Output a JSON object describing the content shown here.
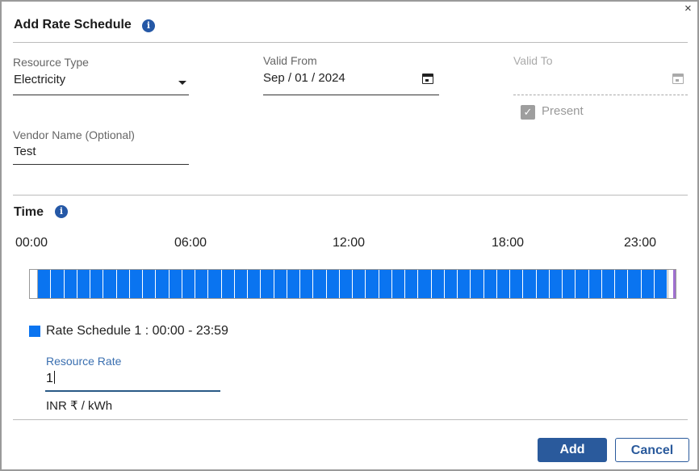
{
  "dialog": {
    "title": "Add Rate Schedule",
    "close": "×",
    "info_glyph": "i"
  },
  "form": {
    "resource_type": {
      "label": "Resource Type",
      "value": "Electricity"
    },
    "valid_from": {
      "label": "Valid From",
      "value": "Sep / 01 / 2024"
    },
    "valid_to": {
      "label": "Valid To",
      "value": ""
    },
    "present": {
      "label": "Present",
      "checked": true,
      "check_glyph": "✓"
    },
    "vendor_name": {
      "label": "Vendor Name (Optional)",
      "value": "Test"
    }
  },
  "time": {
    "title": "Time",
    "ticks": [
      "00:00",
      "06:00",
      "12:00",
      "18:00",
      "23:00"
    ],
    "slots": 48,
    "colors": {
      "selected": "#0a74f0"
    }
  },
  "schedule": {
    "legend": "Rate Schedule 1 : 00:00 - 23:59",
    "rate_label": "Resource Rate",
    "rate_value": "1",
    "unit": "INR ₹ / kWh"
  },
  "buttons": {
    "add": "Add",
    "cancel": "Cancel"
  },
  "icons": {
    "info": "info-icon",
    "calendar": "calendar-icon",
    "close": "close-icon",
    "dropdown": "chevron-down-icon",
    "checkbox": "checkbox-icon"
  }
}
